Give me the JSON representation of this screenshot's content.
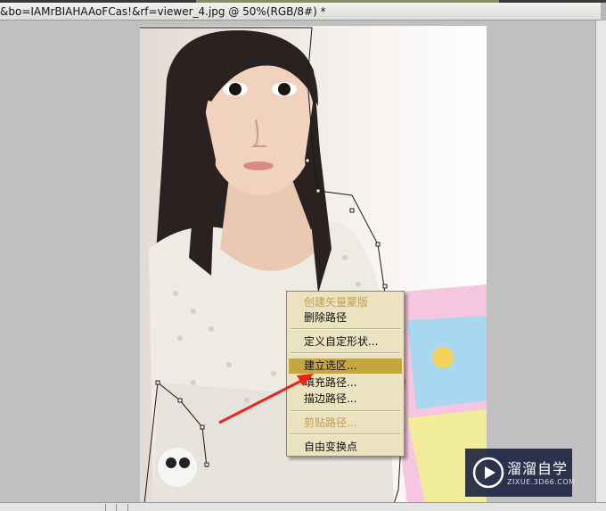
{
  "window": {
    "title": "&bo=IAMrBIAHAAoFCas!&rf=viewer_4.jpg @ 50%(RGB/8#) *"
  },
  "context_menu": {
    "items": [
      {
        "label": "创建矢量蒙版",
        "state": "disabled"
      },
      {
        "label": "删除路径",
        "state": "normal"
      },
      {
        "label": "定义自定形状...",
        "state": "normal"
      },
      {
        "label": "建立选区...",
        "state": "highlighted"
      },
      {
        "label": "填充路径...",
        "state": "normal"
      },
      {
        "label": "描边路径...",
        "state": "normal"
      },
      {
        "label": "剪贴路径...",
        "state": "disabled"
      },
      {
        "label": "自由变换点",
        "state": "normal"
      }
    ]
  },
  "watermark": {
    "name": "溜溜自学",
    "url": "ZIXUE.3D66.COM"
  },
  "colors": {
    "menu_bg": "#ebe2c0",
    "menu_highlight": "#c6a640",
    "disabled_text": "#c0a050",
    "arrow": "#e8261c",
    "logo_bg": "#161e3c"
  }
}
